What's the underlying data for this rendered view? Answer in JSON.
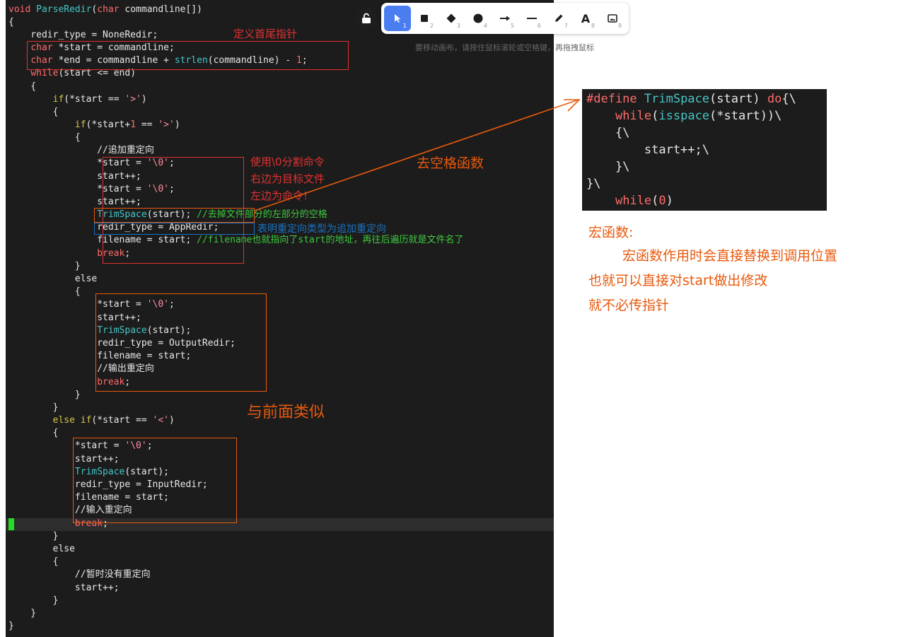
{
  "code": {
    "l0": [
      "void",
      " ",
      "ParseRedir",
      "(",
      "char",
      " commandline[])"
    ],
    "l1": "{",
    "l2": "    redir_type = NoneRedir;",
    "l3": [
      "    ",
      "char",
      " *start = commandline;"
    ],
    "l4": [
      "    ",
      "char",
      " *end = commandline + ",
      "strlen",
      "(commandline) - ",
      "1",
      ";"
    ],
    "l5": [
      "    ",
      "while",
      "(start <= end)"
    ],
    "l6": "    {",
    "l7": [
      "        ",
      "if",
      "(*start == ",
      "'>'",
      ")"
    ],
    "l8": "        {",
    "l9": [
      "            ",
      "if",
      "(*start+",
      "1",
      " == ",
      "'>'",
      ")"
    ],
    "l10": "            {",
    "l11": "                //追加重定向",
    "l12": [
      "                *start = ",
      "'\\0'",
      ";"
    ],
    "l13": "                start++;",
    "l14": [
      "                *start = ",
      "'\\0'",
      ";"
    ],
    "l15": "                start++;",
    "l16": [
      "                ",
      "TrimSpace",
      "(start); ",
      "//去掉文件部分的左部分的空格"
    ],
    "l17": "                redir_type = AppRedir;",
    "l18": [
      "                filename = start; ",
      "//filename也就指向了start的地址，再往后遍历就是文件名了"
    ],
    "l19": [
      "                ",
      "break",
      ";"
    ],
    "l20": "            }",
    "l21": "            else",
    "l22": "            {",
    "l23": [
      "                *start = ",
      "'\\0'",
      ";"
    ],
    "l24": "                start++;",
    "l25": [
      "                ",
      "TrimSpace",
      "(start);"
    ],
    "l26": "                redir_type = OutputRedir;",
    "l27": "                filename = start;",
    "l28": "                //输出重定向",
    "l29": [
      "                ",
      "break",
      ";"
    ],
    "l30": "            }",
    "l31": "        }",
    "l32": [
      "        ",
      "else if",
      "(*start == ",
      "'<'",
      ")"
    ],
    "l33": "        {",
    "l34": [
      "            *start = ",
      "'\\0'",
      ";"
    ],
    "l35": "            start++;",
    "l36": [
      "            ",
      "TrimSpace",
      "(start);"
    ],
    "l37": "            redir_type = InputRedir;",
    "l38": "            filename = start;",
    "l39": "            //输入重定向",
    "l40": [
      "            ",
      "break",
      ";"
    ],
    "l41": "        }",
    "l42": "        else",
    "l43": "        {",
    "l44": "            //暂时没有重定向",
    "l45": "            start++;",
    "l46": "        }",
    "l47": "    }",
    "l48": "}"
  },
  "macro": {
    "m0": [
      "#define ",
      "TrimSpace",
      "(start) ",
      "do",
      "{\\"
    ],
    "m1": [
      "    ",
      "while",
      "(",
      "isspace",
      "(*start))\\"
    ],
    "m2": "    {\\",
    "m3": "        start++;\\",
    "m4": "    }\\",
    "m5": "}\\",
    "m6": [
      "    ",
      "while",
      "(",
      "0",
      ")"
    ]
  },
  "annotations": {
    "define_head_tail": "定义首尾指针",
    "split_1": "使用\\0分割命令",
    "split_2": "右边为目标文件",
    "split_3": "左边为命令!",
    "trim_func": "去空格函数",
    "redir_type_note": "表明重定向类型为追加重定向",
    "similar": "与前面类似",
    "macro_title": "宏函数:",
    "macro_desc_1": "宏函数作用时会直接替换到调用位置",
    "macro_desc_2": "也就可以直接对start做出修改",
    "macro_desc_3": "就不必传指针"
  },
  "toolbar": {
    "hint": "要移动画布，请按住鼠标滚轮或空格键，再拖拽鼠标",
    "tools": [
      {
        "icon": "pointer-icon",
        "num": "1"
      },
      {
        "icon": "rectangle-icon",
        "num": "2"
      },
      {
        "icon": "diamond-icon",
        "num": "3"
      },
      {
        "icon": "ellipse-icon",
        "num": "4"
      },
      {
        "icon": "arrow-icon",
        "num": "5"
      },
      {
        "icon": "line-icon",
        "num": "6"
      },
      {
        "icon": "pencil-icon",
        "num": "7"
      },
      {
        "icon": "text-icon",
        "num": "8",
        "glyph": "A"
      },
      {
        "icon": "image-icon",
        "num": "9"
      }
    ]
  },
  "colors": {
    "red_annotation": "#e03131",
    "orange_annotation": "#e8590c",
    "blue_annotation": "#1971c2",
    "toolbar_active": "#4a7df0"
  }
}
